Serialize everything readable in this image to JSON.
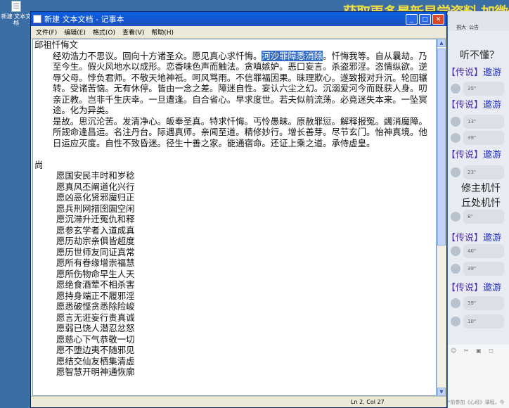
{
  "desktop": {
    "icon_label": "新建 文本文档"
  },
  "watermark": "获取更多最新易学资料 加微信",
  "window": {
    "title": "新建 文本文档 - 记事本",
    "menu": [
      "文件(F)",
      "编辑(E)",
      "格式(O)",
      "查看(V)",
      "帮助(H)"
    ],
    "status": "Ln 2, Col 27"
  },
  "document": {
    "title": "邱祖忏悔文",
    "p1_before": "经劝浩力不思议。回向十方诸圣众。愿见真心求忏悔。",
    "p1_selected": "河沙罪障悉消除",
    "p1_after": "。忏悔我等。自从曩劫。乃至今生。假火风地水以成形。恋香味色声而触法。贪嗔嫉妒。恶口妄言。杀盗邪淫。恣情纵欲。逆辱父母。悖负君师。不敬天地神祇。呵风骂雨。不信罪福因果。昧理欺心。遂致报对升沉。轮回辗转。受诸苦恼。无有休停。皆由一念之差。障迷自性。妄认六尘之幻。沉溺爱河今而既获人身。叨亲正教。岂非千生庆幸。一旦遭逢。自合省心。早求度世。若夫似前流荡。必竟迷失本来。一坠冥途。化为异类。",
    "p2": "是故。思沉沦苦。发清净心。皈奉圣真。特求忏悔。丐怜愚昧。原赦罪愆。解释报冤。蠲消魔障。所觊命逢昌运。名注丹台。际遇真师。亲闻至道。精修妙行。增长善芽。尽节玄门。怡神真境。他日运应灭度。自性不致昏迷。径生十善之家。能通宿命。还证上乘之道。承侍虚皇。",
    "shang": "尚",
    "vows": [
      "愿国安民丰时和岁稔",
      "愿真风丕阐道化兴行",
      "愿凶恶化贤邪魔归正",
      "愿兵刑网措囹圄空闲",
      "愿沉滞升迁冤仇和释",
      "愿参玄学者入道成真",
      "愿历劫宗亲俱皆超度",
      "愿历世师友同证真常",
      "愿所有眷缘增崇福慧",
      "愿所伤物命早生人天",
      "愿绝食酒荤不相杀害",
      "愿持身端正不履邪淫",
      "愿悉破悭贪悉除险峻",
      "愿言无诳妄行贵真诚",
      "愿弱已饶人潜忍忿怒",
      "愿慈心下气恭敬一切",
      "愿不堕边夷不随邪见",
      "愿结交仙友栖集清虚",
      "愿智慧开明神通恢廓"
    ]
  },
  "chat": {
    "top_items": [
      "視大",
      "公告"
    ],
    "question": "听不懂？",
    "legend_label": "【传说】",
    "legend_name": "邀游",
    "voices": [
      "35\"",
      "13\"",
      "39\"",
      "23\"",
      "8\"",
      "40\"",
      "39\"",
      "39\"",
      "10\""
    ],
    "mid_line1": "修主机忏",
    "mid_line2": "丘处机忏",
    "toolbar": "☺ ✂ ▣ ◻",
    "hint": "*前参加《心经》课程，今"
  }
}
